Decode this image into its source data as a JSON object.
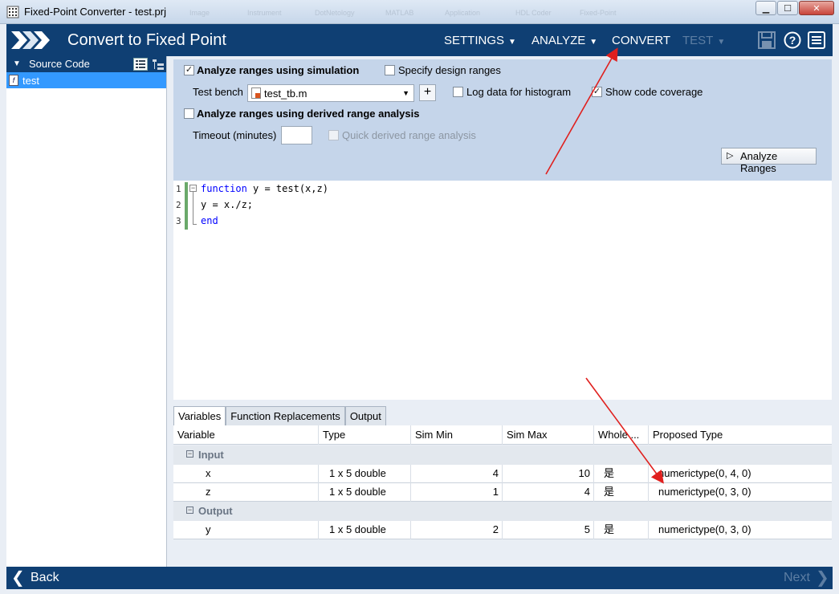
{
  "window": {
    "title": "Fixed-Point Converter - test.prj",
    "background_ghosts": [
      "Image",
      "Instrument",
      "DotNetology",
      "MATLAB",
      "Application",
      "HDL Coder",
      "Fixed-Point"
    ],
    "minimize_glyph": "▁",
    "maximize_glyph": "☐",
    "close_glyph": "✕"
  },
  "header": {
    "title": "Convert to Fixed Point",
    "menus": [
      {
        "label": "SETTINGS",
        "caret": "▼"
      },
      {
        "label": "ANALYZE",
        "caret": "▼"
      },
      {
        "label": "CONVERT",
        "caret": ""
      },
      {
        "label": "TEST",
        "caret": "▼"
      }
    ],
    "icons": [
      "save-icon",
      "help-icon",
      "menu-icon"
    ]
  },
  "left_panel": {
    "header": "Source Code",
    "collapse_glyph": "▼",
    "items": [
      {
        "name": "test",
        "icon": "f"
      }
    ]
  },
  "analyze_panel": {
    "simulation_label": "Analyze ranges using simulation",
    "simulation_checked": "✓",
    "design_ranges_label": "Specify design ranges",
    "test_bench_label": "Test bench",
    "test_bench_value": "test_tb.m",
    "dropdown_glyph": "▼",
    "add_glyph": "+",
    "log_histogram_label": "Log data for histogram",
    "show_coverage_label": "Show code coverage",
    "show_coverage_checked": "✓",
    "derived_label": "Analyze ranges using derived range analysis",
    "timeout_label": "Timeout (minutes)",
    "quick_derived_label": "Quick derived range analysis",
    "analyze_button": "Analyze Ranges",
    "play_glyph": "▷"
  },
  "editor": {
    "fold_glyph": "−",
    "lines": [
      {
        "num": "1",
        "keyword": "function",
        "text": " y = test(x,z)"
      },
      {
        "num": "2",
        "keyword": "",
        "text": "y = x./z;"
      },
      {
        "num": "3",
        "keyword": "end",
        "text": ""
      }
    ]
  },
  "tabs": [
    "Variables",
    "Function Replacements",
    "Output"
  ],
  "variables_table": {
    "columns": [
      "Variable",
      "Type",
      "Sim Min",
      "Sim Max",
      "Whole ...",
      "Proposed Type"
    ],
    "collapse_glyph": "−",
    "groups": [
      {
        "name": "Input",
        "rows": [
          {
            "variable": "x",
            "type": "1 x 5 double",
            "sim_min": "4",
            "sim_max": "10",
            "whole": "是",
            "proposed": "numerictype(0, 4, 0)"
          },
          {
            "variable": "z",
            "type": "1 x 5 double",
            "sim_min": "1",
            "sim_max": "4",
            "whole": "是",
            "proposed": "numerictype(0, 3, 0)"
          }
        ]
      },
      {
        "name": "Output",
        "rows": [
          {
            "variable": "y",
            "type": "1 x 5 double",
            "sim_min": "2",
            "sim_max": "5",
            "whole": "是",
            "proposed": "numerictype(0, 3, 0)"
          }
        ]
      }
    ]
  },
  "footer": {
    "back": "Back",
    "next": "Next",
    "back_glyph": "❮",
    "next_glyph": "❯"
  },
  "colors": {
    "header_bg": "#0f3f73",
    "panel_bg": "#c5d5ea",
    "selection": "#3399ff",
    "annotation_arrow": "#e0201e"
  }
}
